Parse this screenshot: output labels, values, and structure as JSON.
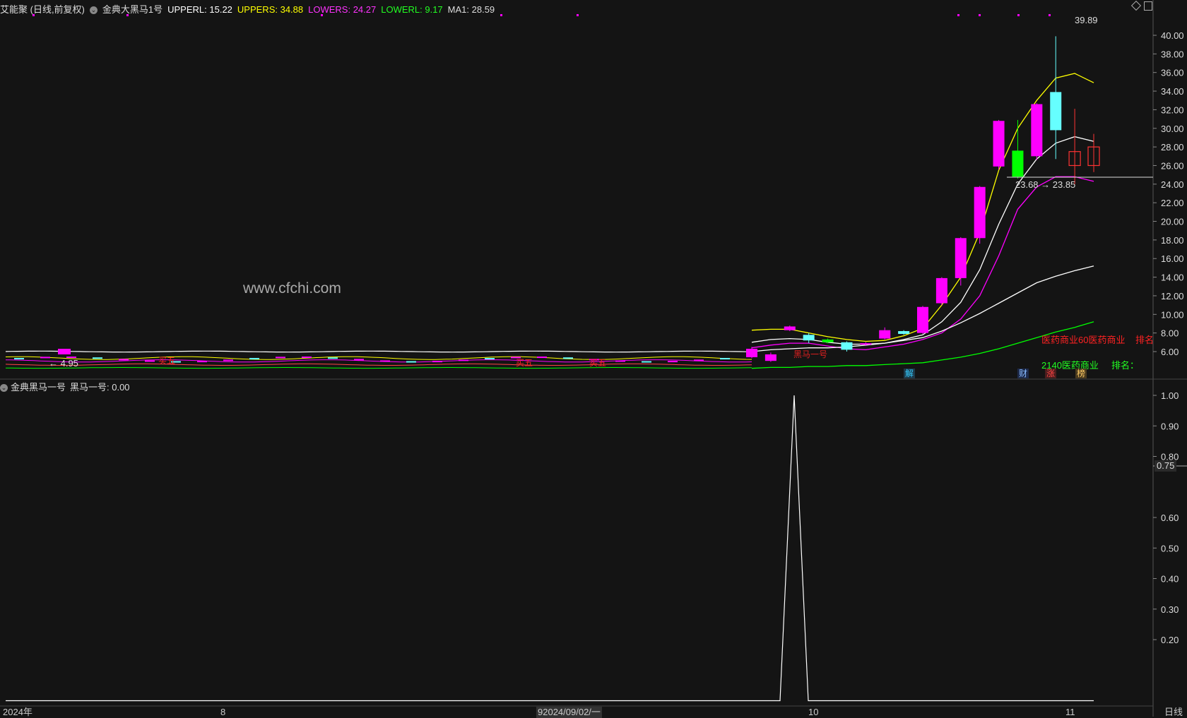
{
  "header": {
    "stock_name": "艾能聚 (日线,前复权)",
    "indicator_name": "金典大黑马1号",
    "upperl": "UPPERL: 15.22",
    "uppers": "UPPERS: 34.88",
    "lowers": "LOWERS: 24.27",
    "lowerl": "LOWERL: 9.17",
    "ma1": "MA1: 28.59"
  },
  "lower_header": {
    "indicator_name": "金典黑马一号",
    "value_text": "黑马一号: 0.00"
  },
  "annotations": {
    "high_label": "39.89",
    "low_label": "← 4.95",
    "price_line_label": "23.68 → 23.85",
    "watermark": "www.cfchi.com",
    "sector_rank_1": "医药商业60医药商业",
    "rank_label_1": "排名",
    "sector_rank_2": "2140医药商业",
    "rank_label_2": "排名：",
    "marker_jie": "解",
    "marker_cai": "财",
    "marker_zhang": "涨",
    "marker_bang": "榜",
    "signal_text_a": "买五",
    "signal_text_b": "买五",
    "signal_text_c": "买五",
    "signal_text_d": "黑马一号",
    "lower_cursor_value": "0.75"
  },
  "x_axis": {
    "labels": [
      "2024年",
      "8",
      "92024/09/02/一",
      "10",
      "11"
    ],
    "period_label": "日线"
  },
  "colors": {
    "background": "#141414",
    "up": "#ff00ff",
    "down_green": "#00ff00",
    "down_cyan": "#66ffff",
    "uppers_line": "#ffff00",
    "lowers_line": "#ff00ff",
    "lowerl_line": "#00ff00",
    "upperl_line": "#ffffff",
    "ma1_line": "#ffffff"
  },
  "chart_data": [
    {
      "type": "candlestick",
      "title": "艾能聚 (日线,前复权)",
      "ylim": [
        4.0,
        40.5
      ],
      "y_ticks": [
        "40.00",
        "38.00",
        "36.00",
        "34.00",
        "32.00",
        "30.00",
        "28.00",
        "26.00",
        "24.00",
        "22.00",
        "20.00",
        "18.00",
        "16.00",
        "14.00",
        "12.00",
        "10.00",
        "8.00",
        "6.00"
      ],
      "candles": [
        {
          "o": 5.4,
          "c": 6.3,
          "h": 6.5,
          "l": 5.3
        },
        {
          "o": 5.0,
          "c": 5.7,
          "h": 5.9,
          "l": 4.9
        },
        {
          "o": 8.3,
          "c": 8.7,
          "h": 8.8,
          "l": 8.2
        },
        {
          "o": 7.8,
          "c": 7.2,
          "h": 8.0,
          "l": 6.9
        },
        {
          "o": 7.3,
          "c": 7.0,
          "h": 7.4,
          "l": 6.9
        },
        {
          "o": 7.0,
          "c": 6.2,
          "h": 7.1,
          "l": 6.0
        },
        {
          "o": 6.8,
          "c": 6.9,
          "h": 7.0,
          "l": 6.6
        },
        {
          "o": 7.4,
          "c": 8.3,
          "h": 8.6,
          "l": 7.3
        },
        {
          "o": 8.2,
          "c": 7.9,
          "h": 8.3,
          "l": 7.8
        },
        {
          "o": 8.0,
          "c": 10.8,
          "h": 10.9,
          "l": 7.9
        },
        {
          "o": 11.2,
          "c": 13.9,
          "h": 14.0,
          "l": 11.0
        },
        {
          "o": 13.9,
          "c": 18.2,
          "h": 18.3,
          "l": 13.1
        },
        {
          "o": 18.2,
          "c": 23.7,
          "h": 23.8,
          "l": 17.6
        },
        {
          "o": 25.9,
          "c": 30.8,
          "h": 30.9,
          "l": 25.6
        },
        {
          "o": 27.6,
          "c": 24.8,
          "h": 30.9,
          "l": 24.6
        },
        {
          "o": 27.0,
          "c": 32.6,
          "h": 32.7,
          "l": 26.6
        },
        {
          "o": 33.9,
          "c": 29.8,
          "h": 39.9,
          "l": 26.7
        },
        {
          "o": 26.0,
          "c": 27.5,
          "h": 32.1,
          "l": 24.0
        },
        {
          "o": 26.0,
          "c": 28.0,
          "h": 29.4,
          "l": 25.3
        }
      ],
      "series": [
        {
          "name": "UPPERS",
          "values": [
            8.3,
            8.4,
            8.4,
            8.0,
            7.6,
            7.3,
            7.1,
            7.2,
            7.7,
            8.5,
            11.0,
            14.0,
            18.8,
            25.5,
            30.0,
            33.0,
            35.4,
            35.9,
            34.9
          ]
        },
        {
          "name": "LOWERS",
          "values": [
            6.4,
            6.7,
            6.9,
            6.9,
            6.6,
            6.3,
            6.2,
            6.5,
            6.8,
            7.3,
            8.0,
            9.5,
            12.0,
            16.3,
            21.3,
            23.7,
            24.8,
            24.8,
            24.3
          ]
        },
        {
          "name": "MA1",
          "values": [
            7.0,
            7.3,
            7.4,
            7.3,
            7.0,
            6.8,
            6.8,
            6.9,
            7.3,
            7.8,
            9.2,
            11.3,
            14.8,
            19.7,
            24.0,
            26.7,
            28.4,
            29.1,
            28.6
          ]
        },
        {
          "name": "UPPERL",
          "values": [
            6.0,
            6.2,
            6.3,
            6.4,
            6.4,
            6.5,
            6.7,
            6.9,
            7.2,
            7.5,
            8.2,
            9.1,
            10.1,
            11.2,
            12.3,
            13.4,
            14.1,
            14.7,
            15.2
          ]
        },
        {
          "name": "LOWERL",
          "values": [
            4.2,
            4.3,
            4.3,
            4.4,
            4.4,
            4.5,
            4.5,
            4.6,
            4.7,
            4.8,
            5.1,
            5.4,
            5.8,
            6.3,
            6.9,
            7.5,
            8.1,
            8.6,
            9.2
          ]
        }
      ]
    },
    {
      "type": "line",
      "title": "金典黑马一号",
      "ylim": [
        0,
        1.05
      ],
      "y_ticks": [
        "1.00",
        "0.90",
        "0.80",
        "0.60",
        "0.50",
        "0.40",
        "0.30",
        "0.20"
      ],
      "series": [
        {
          "name": "黑马一号",
          "peak_value": 1.0,
          "baseline_value": 0.0
        }
      ]
    }
  ]
}
